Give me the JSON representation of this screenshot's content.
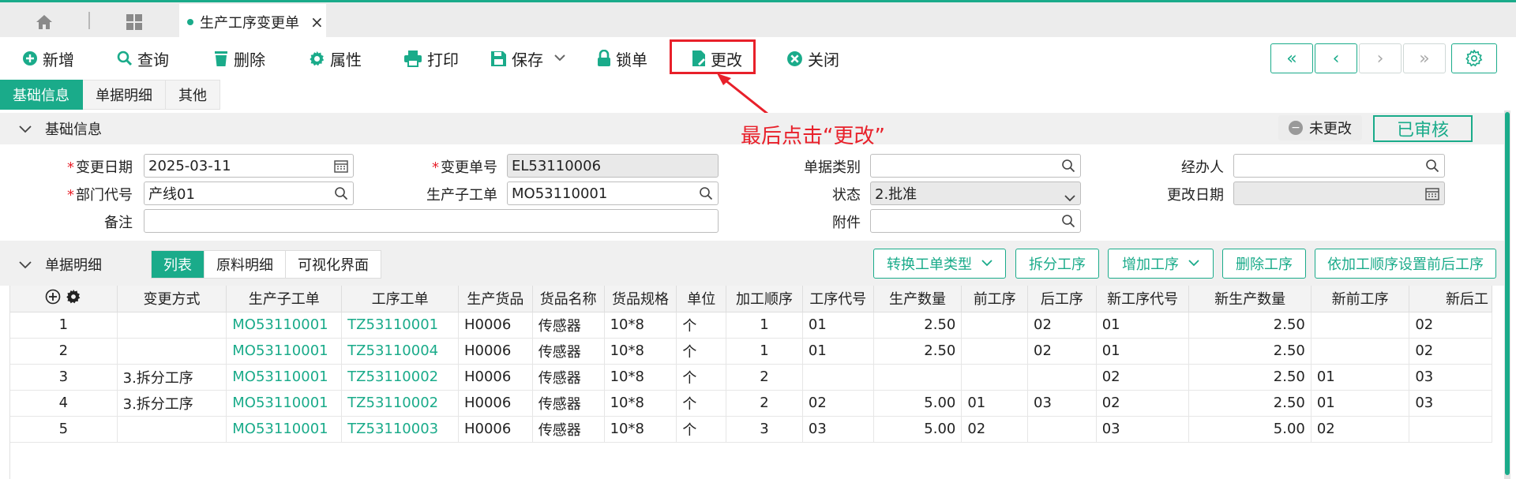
{
  "tabs": {
    "active_tab_label": "生产工序变更单",
    "close": "×"
  },
  "toolbar": {
    "new": "新增",
    "query": "查询",
    "delete": "删除",
    "properties": "属性",
    "print": "打印",
    "save": "保存",
    "lock": "锁单",
    "change": "更改",
    "close": "关闭"
  },
  "nav": {
    "first": "«",
    "prev": "‹",
    "next": "›",
    "last": "»"
  },
  "section_tabs": [
    "基础信息",
    "单据明细",
    "其他"
  ],
  "basic": {
    "title": "基础信息",
    "annotation": "最后点击“更改”",
    "status_chip": "未更改",
    "audit_stamp": "已审核",
    "labels": {
      "change_date": "变更日期",
      "change_no": "变更单号",
      "doc_type": "单据类别",
      "handler": "经办人",
      "dept_code": "部门代号",
      "sub_order": "生产子工单",
      "status": "状态",
      "modify_date": "更改日期",
      "remark": "备注",
      "attachment": "附件"
    },
    "values": {
      "change_date": "2025-03-11",
      "change_no": "EL53110006",
      "doc_type": "",
      "handler": "",
      "dept_code": "产线01",
      "sub_order": "MO53110001",
      "status": "2.批准",
      "modify_date": "",
      "remark": "",
      "attachment": ""
    }
  },
  "detail": {
    "title": "单据明细",
    "view_tabs": [
      "列表",
      "原料明细",
      "可视化界面"
    ],
    "actions": {
      "convert": "转换工单类型",
      "split": "拆分工序",
      "add": "增加工序",
      "remove": "删除工序",
      "set_order": "依加工顺序设置前后工序"
    },
    "columns": [
      "变更方式",
      "生产子工单",
      "工序工单",
      "生产货品",
      "货品名称",
      "货品规格",
      "单位",
      "加工顺序",
      "工序代号",
      "生产数量",
      "前工序",
      "后工序",
      "新工序代号",
      "新生产数量",
      "新前工序",
      "新后工"
    ],
    "rows": [
      {
        "idx": "1",
        "mode": "",
        "sub": "MO53110001",
        "proc": "TZ53110001",
        "item": "H0006",
        "name": "传感器",
        "spec": "10*8",
        "unit": "个",
        "seq": "1",
        "code": "01",
        "qty": "2.50",
        "prev": "",
        "next": "02",
        "ncode": "01",
        "nqty": "2.50",
        "nprev": "",
        "nnext": "02"
      },
      {
        "idx": "2",
        "mode": "",
        "sub": "MO53110001",
        "proc": "TZ53110004",
        "item": "H0006",
        "name": "传感器",
        "spec": "10*8",
        "unit": "个",
        "seq": "1",
        "code": "01",
        "qty": "2.50",
        "prev": "",
        "next": "02",
        "ncode": "01",
        "nqty": "2.50",
        "nprev": "",
        "nnext": "02"
      },
      {
        "idx": "3",
        "mode": "3.拆分工序",
        "sub": "MO53110001",
        "proc": "TZ53110002",
        "item": "H0006",
        "name": "传感器",
        "spec": "10*8",
        "unit": "个",
        "seq": "2",
        "code": "",
        "qty": "",
        "prev": "",
        "next": "",
        "ncode": "02",
        "nqty": "2.50",
        "nprev": "01",
        "nnext": "03"
      },
      {
        "idx": "4",
        "mode": "3.拆分工序",
        "sub": "MO53110001",
        "proc": "TZ53110002",
        "item": "H0006",
        "name": "传感器",
        "spec": "10*8",
        "unit": "个",
        "seq": "2",
        "code": "02",
        "qty": "5.00",
        "prev": "01",
        "next": "03",
        "ncode": "02",
        "nqty": "2.50",
        "nprev": "01",
        "nnext": "03"
      },
      {
        "idx": "5",
        "mode": "",
        "sub": "MO53110001",
        "proc": "TZ53110003",
        "item": "H0006",
        "name": "传感器",
        "spec": "10*8",
        "unit": "个",
        "seq": "3",
        "code": "03",
        "qty": "5.00",
        "prev": "02",
        "next": "",
        "ncode": "03",
        "nqty": "5.00",
        "nprev": "02",
        "nnext": ""
      }
    ]
  },
  "colors": {
    "accent": "#1aab8a",
    "annotation": "#e8202a"
  }
}
